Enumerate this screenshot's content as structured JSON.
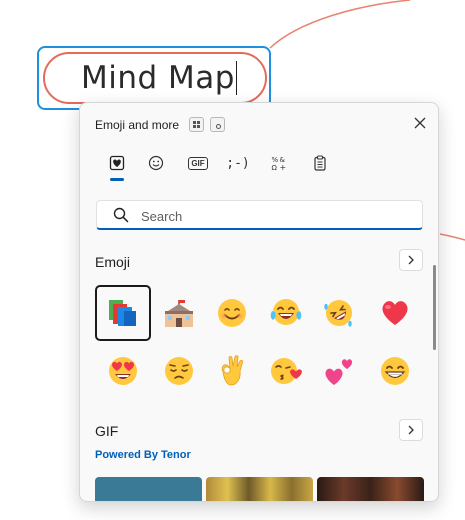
{
  "canvas": {
    "node_text": "Mind Map",
    "colors": {
      "selection": "#1e90e0",
      "node_border": "#e46b5c",
      "connector": "#e9846f"
    }
  },
  "panel": {
    "title": "Emoji and more",
    "close_icon": "close-icon",
    "tabs": [
      {
        "label": "Emoji",
        "icon": "heart-tab-icon",
        "active": true
      },
      {
        "label": "Kaomoji-face",
        "icon": "smiley-tab-icon",
        "active": false
      },
      {
        "label": "GIF",
        "icon": "gif-tab-icon",
        "active": false
      },
      {
        "label": ";-)",
        "icon": "kaomoji-tab-icon",
        "active": false
      },
      {
        "label": "Symbols",
        "icon": "symbols-tab-icon",
        "active": false
      },
      {
        "label": "Clipboard",
        "icon": "clipboard-tab-icon",
        "active": false
      }
    ],
    "gif_tab_text": "GIF",
    "kaomoji_tab_text": ";-)",
    "search": {
      "placeholder": "Search",
      "value": ""
    },
    "sections": {
      "emoji": {
        "title": "Emoji"
      },
      "gif": {
        "title": "GIF",
        "powered_by": "Powered By Tenor"
      }
    },
    "emoji": [
      "books",
      "school",
      "smiling-face",
      "face-with-tears-of-joy",
      "rolling-on-the-floor-laughing",
      "red-heart",
      "smiling-face-with-heart-eyes",
      "pensive-face",
      "ok-hand",
      "face-blowing-kiss",
      "two-hearts",
      "grinning-face"
    ],
    "accent_color": "#005fb8"
  }
}
